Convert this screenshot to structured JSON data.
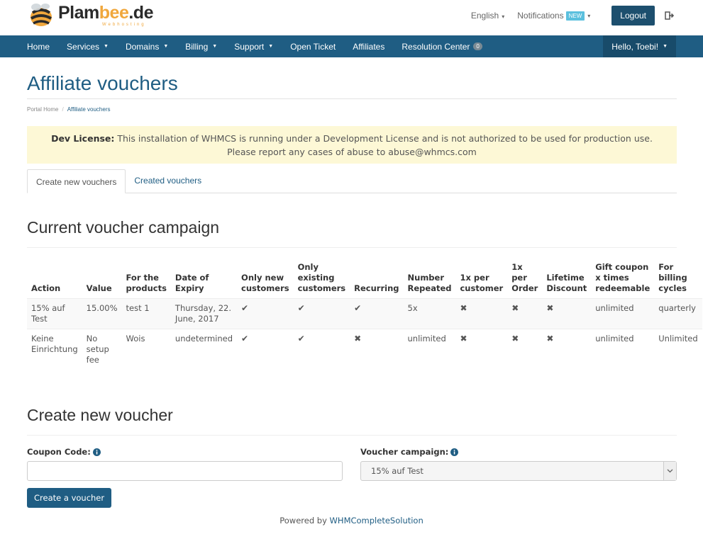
{
  "header": {
    "logo": {
      "part_a": "Plam",
      "part_b": "bee",
      "part_c": ".de",
      "sub": "Webhosting"
    },
    "language": "English",
    "notifications": "Notifications",
    "notifications_badge": "NEW",
    "logout": "Logout"
  },
  "nav": {
    "items": [
      {
        "label": "Home"
      },
      {
        "label": "Services"
      },
      {
        "label": "Domains"
      },
      {
        "label": "Billing"
      },
      {
        "label": "Support"
      },
      {
        "label": "Open Ticket"
      },
      {
        "label": "Affiliates"
      },
      {
        "label": "Resolution Center",
        "badge": "0"
      }
    ],
    "user": "Hello, Toebi!"
  },
  "page": {
    "title": "Affiliate vouchers",
    "breadcrumb": {
      "home": "Portal Home",
      "current": "Affiliate vouchers"
    }
  },
  "alert": {
    "strong": "Dev License:",
    "text": "This installation of WHMCS is running under a Development License and is not authorized to be used for production use. Please report any cases of abuse to abuse@whmcs.com"
  },
  "tabs": {
    "create": "Create new vouchers",
    "created": "Created vouchers"
  },
  "campaign": {
    "title": "Current voucher campaign",
    "headers": [
      "Action",
      "Value",
      "For the products",
      "Date of Expiry",
      "Only new customers",
      "Only existing customers",
      "Recurring",
      "Number Repeated",
      "1x per customer",
      "1x per Order",
      "Lifetime Discount",
      "Gift coupon x times redeemable",
      "For billing cycles"
    ],
    "rows": [
      [
        "15% auf Test",
        "15.00%",
        "test 1",
        "Thursday, 22. June, 2017",
        "✔",
        "✔",
        "✔",
        "5x",
        "✖",
        "✖",
        "✖",
        "unlimited",
        "quarterly"
      ],
      [
        "Keine Einrichtung",
        "No setup fee",
        "Wois",
        "undetermined",
        "✔",
        "✔",
        "✖",
        "unlimited",
        "✖",
        "✖",
        "✖",
        "unlimited",
        "Unlimited"
      ]
    ]
  },
  "form": {
    "title": "Create new voucher",
    "coupon_label": "Coupon Code:",
    "coupon_value": "",
    "campaign_label": "Voucher campaign:",
    "campaign_selected": "15% auf Test",
    "submit": "Create a voucher"
  },
  "footer": {
    "prefix": "Powered by",
    "link": "WHMCompleteSolution"
  },
  "colors": {
    "primary": "#1f5d83",
    "alert_bg": "#fdf8d6",
    "accent": "#f0a73c",
    "badge": "#5bc0de"
  }
}
